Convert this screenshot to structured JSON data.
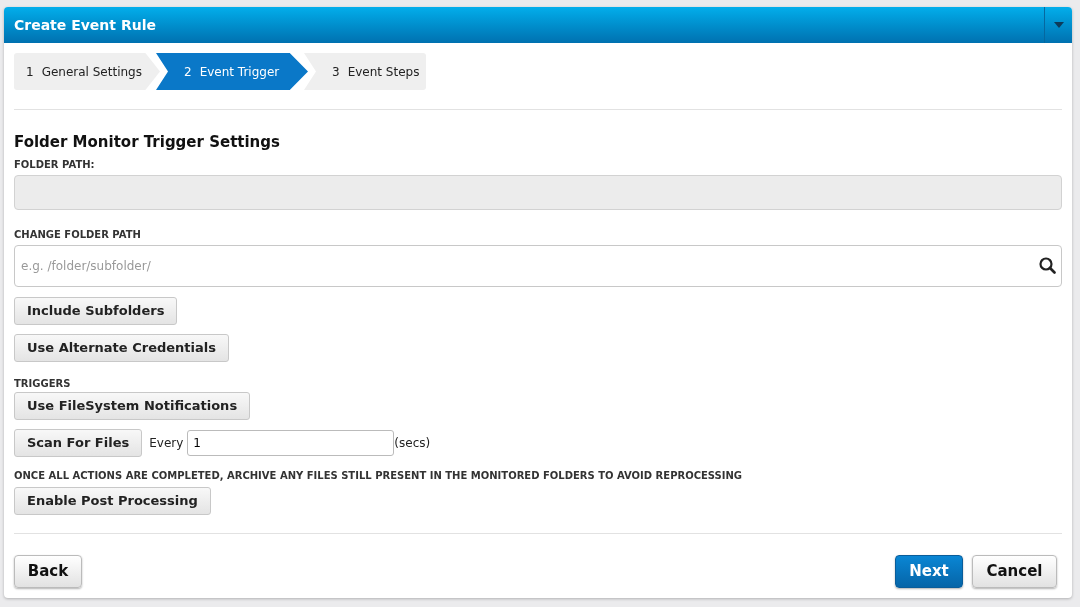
{
  "window": {
    "title": "Create Event Rule"
  },
  "steps": [
    {
      "number": "1",
      "label": "General Settings",
      "selected": false
    },
    {
      "number": "2",
      "label": "Event Trigger",
      "selected": true
    },
    {
      "number": "3",
      "label": "Event Steps",
      "selected": false
    }
  ],
  "section_title": "Folder Monitor Trigger Settings",
  "folder_path": {
    "label": "FOLDER PATH:"
  },
  "change_folder_path": {
    "label": "CHANGE FOLDER PATH",
    "placeholder": "e.g. /folder/subfolder/"
  },
  "options": [
    "Include Subfolders",
    "Use Alternate Credentials"
  ],
  "triggers": {
    "label": "TRIGGERS",
    "filesystem_button": "Use FileSystem Notifications",
    "scan_button": "Scan For Files",
    "every_label": "Every",
    "interval": "1",
    "unit": "(secs)"
  },
  "post_processing": {
    "label": "ONCE ALL ACTIONS ARE COMPLETED, ARCHIVE ANY FILES STILL PRESENT IN THE MONITORED FOLDERS TO AVOID REPROCESSING",
    "button": "Enable Post Processing"
  },
  "footer": {
    "back": "Back",
    "next": "Next",
    "cancel": "Cancel"
  }
}
